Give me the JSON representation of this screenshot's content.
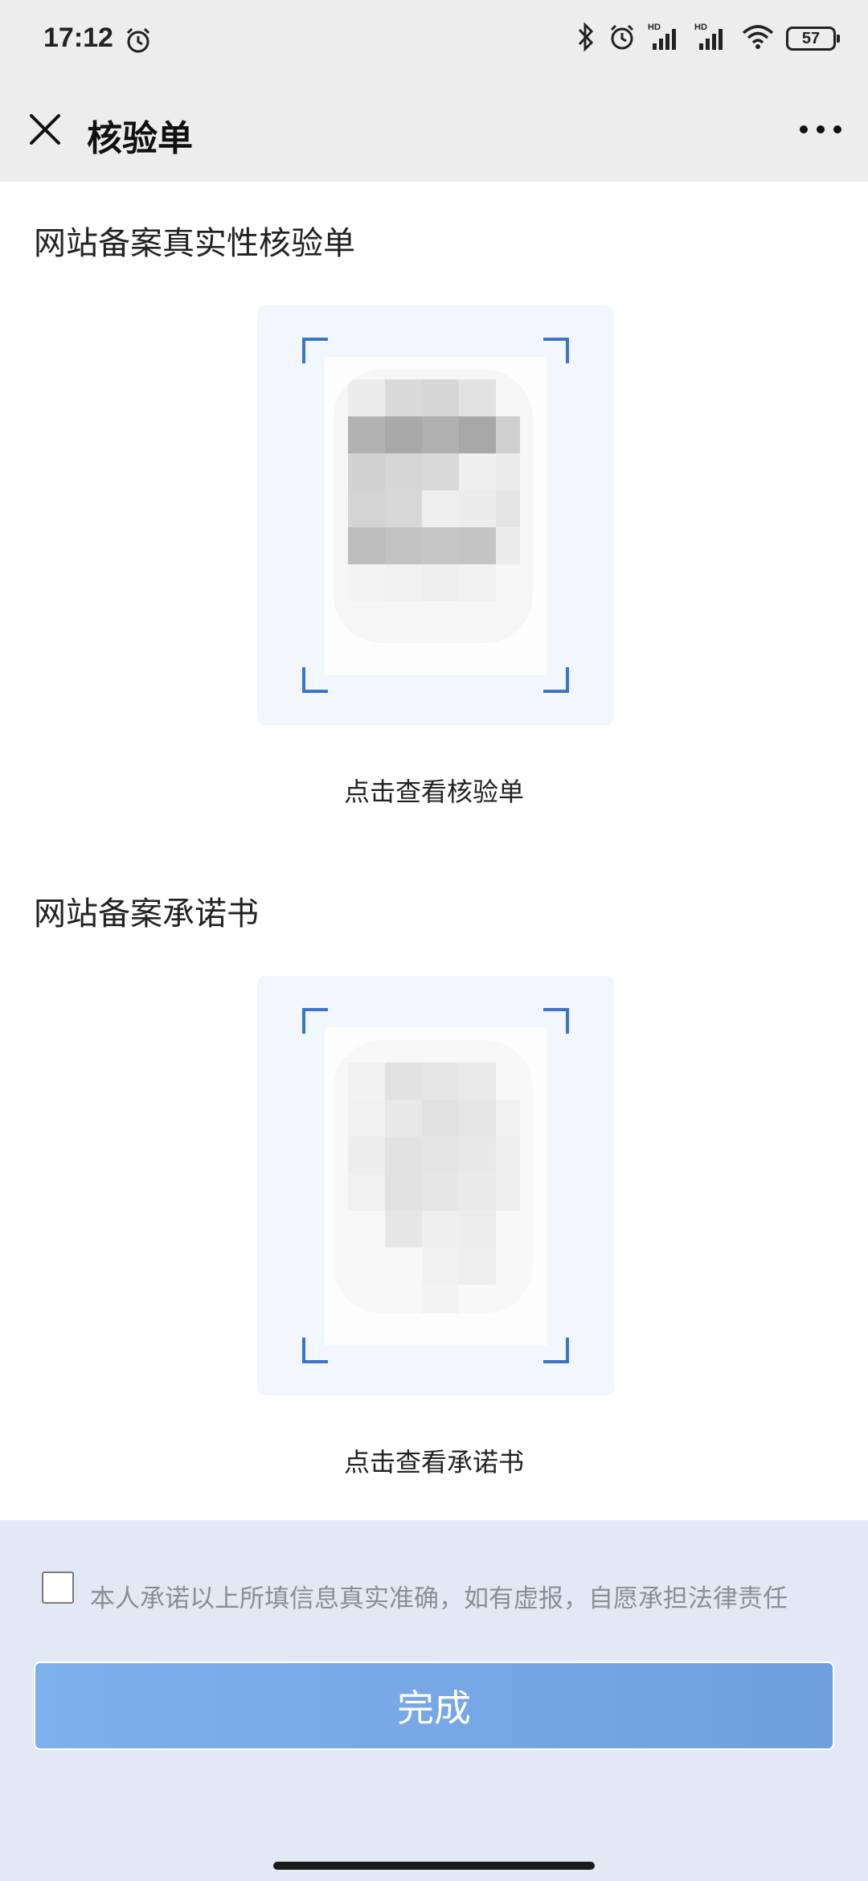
{
  "status_bar": {
    "time": "17:12",
    "battery": "57",
    "icons": [
      "alarm-icon",
      "bluetooth-icon",
      "alarm-icon",
      "hd-signal-icon",
      "hd-signal-icon",
      "wifi-icon",
      "battery-icon"
    ]
  },
  "header": {
    "title": "核验单",
    "close_icon": "close-icon",
    "more_icon": "more-icon"
  },
  "sections": [
    {
      "title": "网站备案真实性核验单",
      "link": "点击查看核验单"
    },
    {
      "title": "网站备案承诺书",
      "link": "点击查看承诺书"
    }
  ],
  "footer": {
    "agreement": "本人承诺以上所填信息真实准确，如有虚报，自愿承担法律责任",
    "checked": false,
    "done_label": "完成"
  },
  "colors": {
    "accent": "#3d74c8",
    "button": "#7fb0ec",
    "panel": "#e3e9f4",
    "card": "#f2f6fd"
  }
}
